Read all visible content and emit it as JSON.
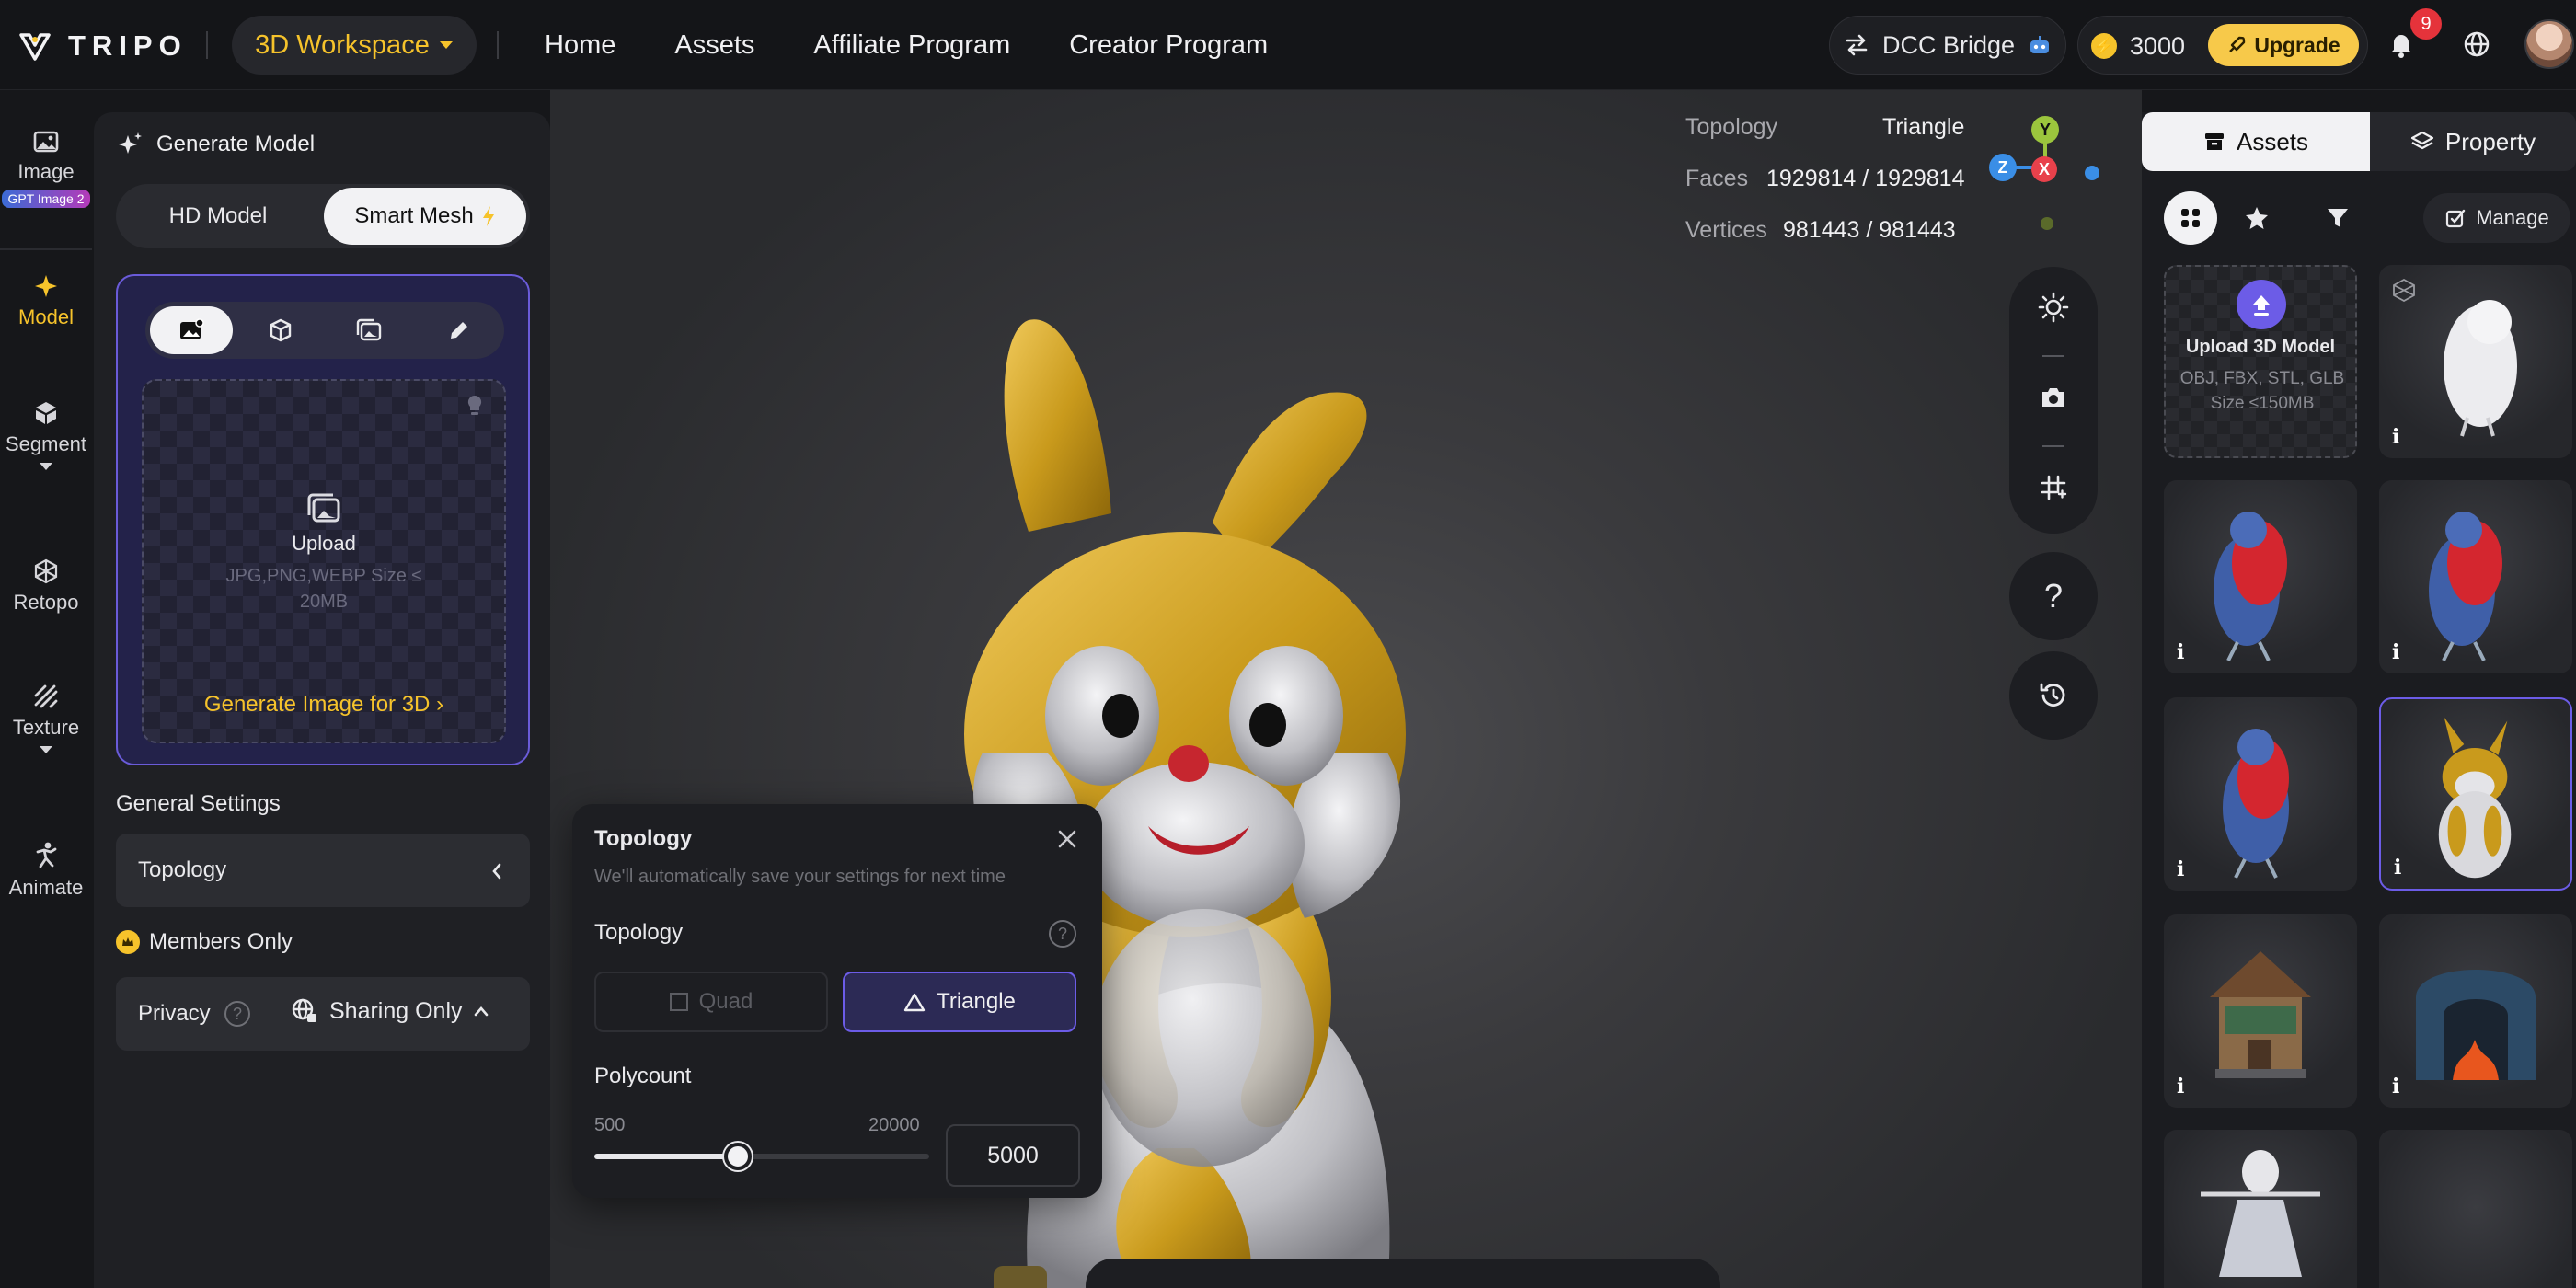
{
  "topbar": {
    "brand": "TRIPO",
    "workspace": "3D Workspace",
    "nav": [
      "Home",
      "Assets",
      "Affiliate Program",
      "Creator Program"
    ],
    "dcc_bridge": "DCC Bridge",
    "credits": "3000",
    "upgrade": "Upgrade",
    "notifications": "9"
  },
  "rail": {
    "image": "Image",
    "image_tag": "GPT Image 2",
    "model": "Model",
    "segment": "Segment",
    "retopo": "Retopo",
    "texture": "Texture",
    "animate": "Animate"
  },
  "generate": {
    "title": "Generate Model",
    "mode_hd": "HD Model",
    "mode_smart": "Smart Mesh",
    "upload_label": "Upload",
    "upload_hint": "JPG,PNG,WEBP Size ≤ 20MB",
    "generate_image_link": "Generate Image for 3D",
    "general_settings": "General Settings",
    "topology_row": "Topology",
    "members_only": "Members Only",
    "privacy_label": "Privacy",
    "privacy_value": "Sharing Only"
  },
  "viewport": {
    "topology_label": "Topology",
    "topology_value": "Triangle",
    "faces_label": "Faces",
    "faces_value": "1929814 / 1929814",
    "vertices_label": "Vertices",
    "vertices_value": "981443 / 981443",
    "axis_y": "Y",
    "axis_x": "X",
    "axis_z": "Z",
    "help": "?"
  },
  "topology_popup": {
    "title": "Topology",
    "subtitle": "We'll automatically save your settings for next time",
    "section_topology": "Topology",
    "opt_quad": "Quad",
    "opt_triangle": "Triangle",
    "section_polycount": "Polycount",
    "min": "500",
    "max": "20000",
    "value": "5000",
    "value_number": 5000,
    "min_number": 500,
    "max_number": 20000
  },
  "right_panel": {
    "tab_assets": "Assets",
    "tab_property": "Property",
    "manage": "Manage",
    "upload_title": "Upload 3D Model",
    "upload_hint": "OBJ, FBX, STL, GLB Size ≤150MB",
    "info": "i"
  },
  "colors": {
    "accent_yellow": "#f6c32b",
    "accent_purple": "#6c5ce7",
    "gold": "#c99a1c"
  }
}
